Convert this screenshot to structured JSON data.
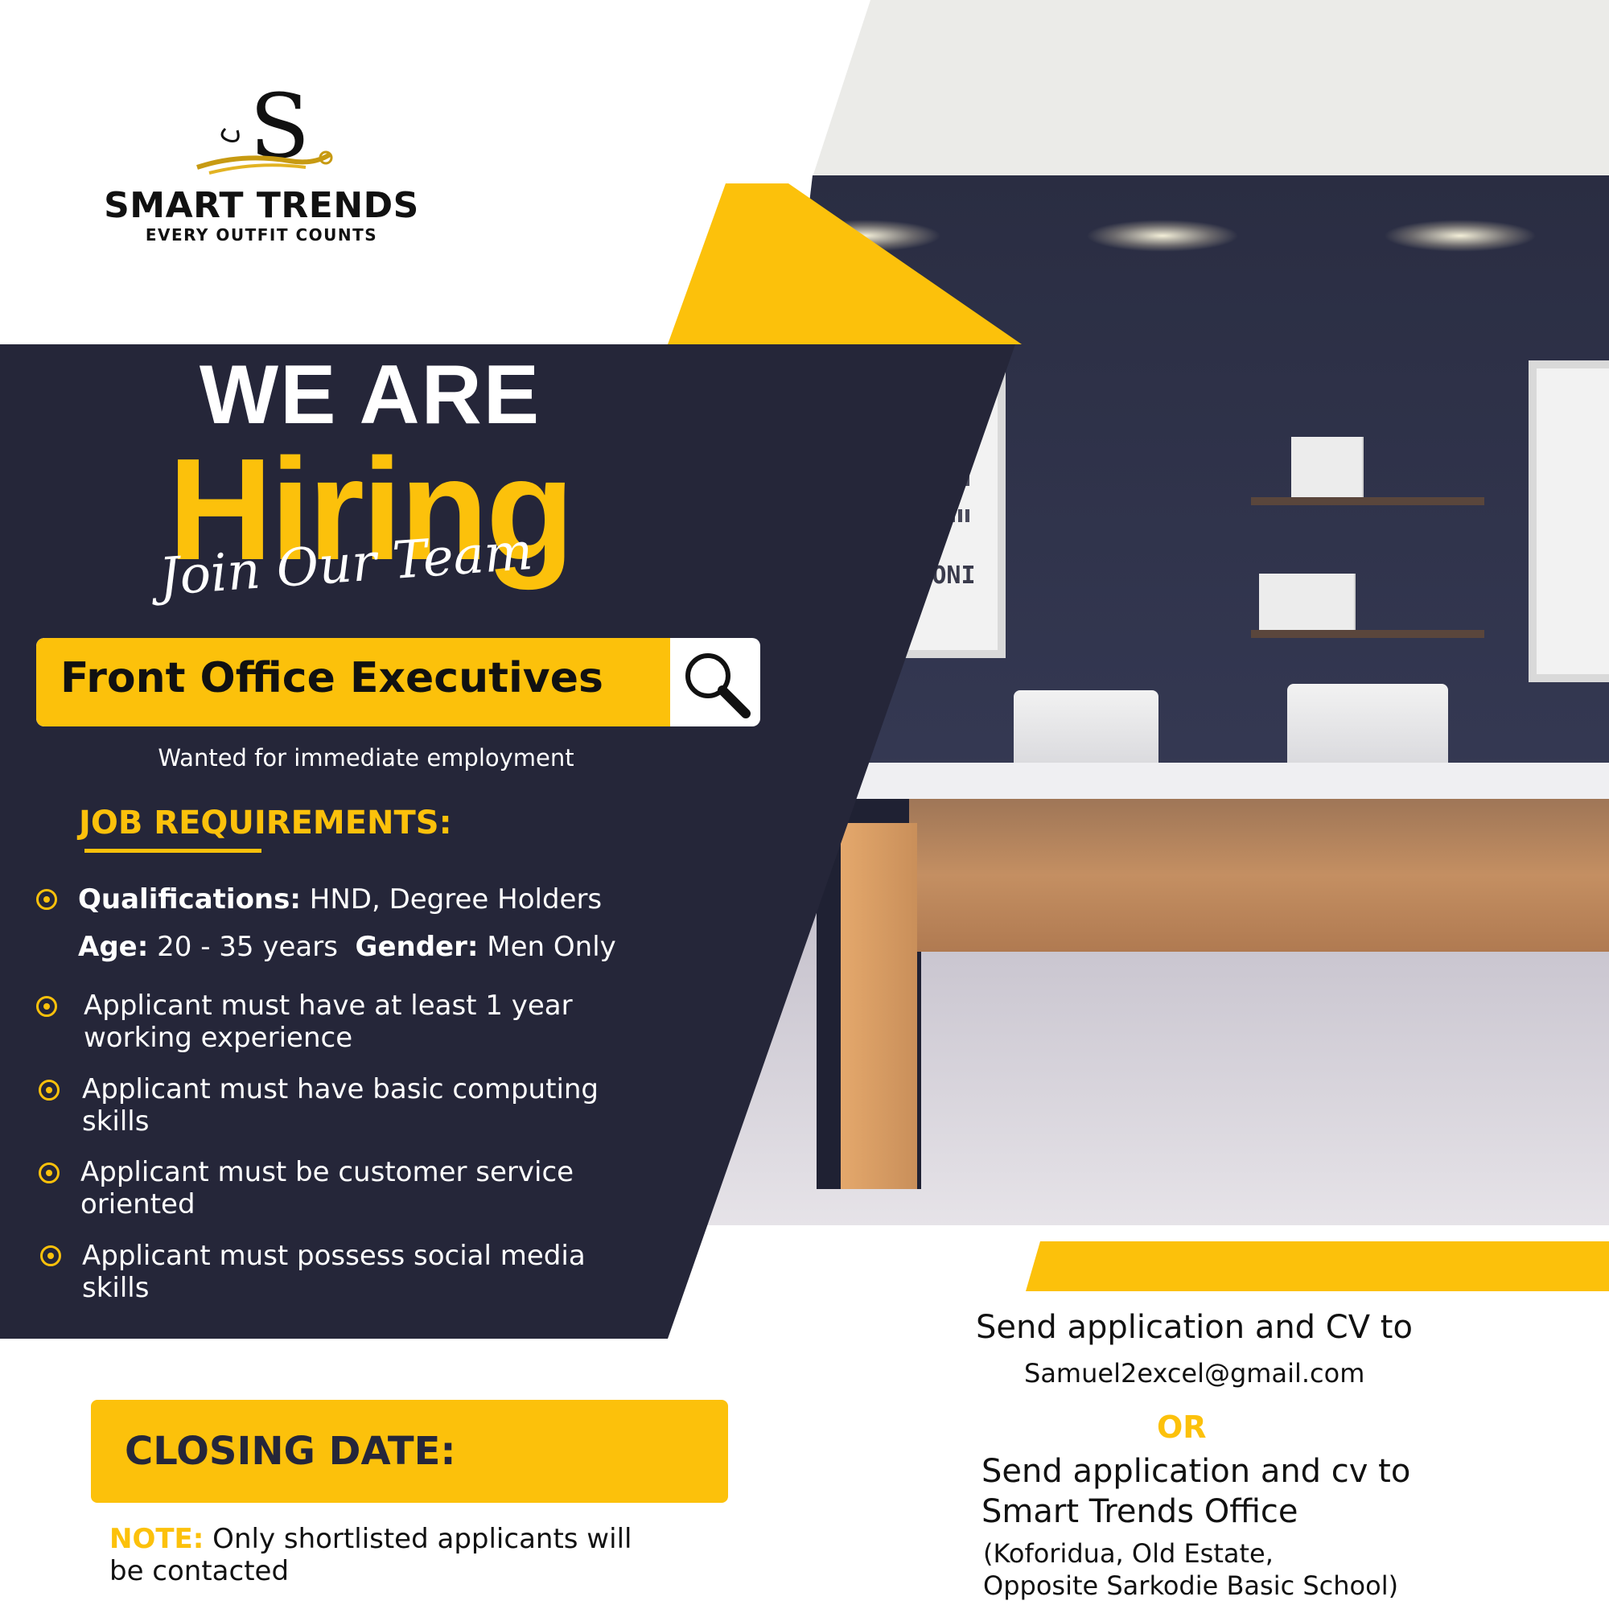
{
  "brand": {
    "name": "SMART TRENDS",
    "tagline": "EVERY OUTFIT COUNTS",
    "logo_icon": "script-s-logo-icon",
    "colors": {
      "accent": "#fcc10b",
      "panel": "#252639"
    }
  },
  "headline": {
    "line1": "WE ARE",
    "line2": "Hiring",
    "script": "Join Our Team"
  },
  "role": {
    "title": "Front Office Executives",
    "icon": "search-icon",
    "subtitle": "Wanted for immediate employment"
  },
  "requirements": {
    "heading": "JOB REQUIREMENTS:",
    "qualifications_label": "Qualifications:",
    "qualifications_value": " HND, Degree Holders",
    "age_label": "Age:",
    "age_value": " 20 - 35 years",
    "gender_label": "Gender:",
    "gender_value": " Men Only",
    "items": [
      "Applicant must have at least 1 year working experience",
      "Applicant must have basic computing skills",
      "Applicant must be customer service oriented",
      "Applicant must possess social media skills"
    ]
  },
  "closing": {
    "label": "CLOSING DATE:",
    "note_label": "NOTE:",
    "note_text": " Only shortlisted applicants will be contacted"
  },
  "apply": {
    "line1": "Send application and CV to",
    "email": "Samuel2excel@gmail.com",
    "or": "OR",
    "line2a": "Send application and cv to",
    "line2b": "Smart Trends Office",
    "address1": "(Koforidua, Old Estate,",
    "address2": "Opposite Sarkodie Basic School)"
  },
  "photo": {
    "poster_text": "CLIANIONI"
  }
}
